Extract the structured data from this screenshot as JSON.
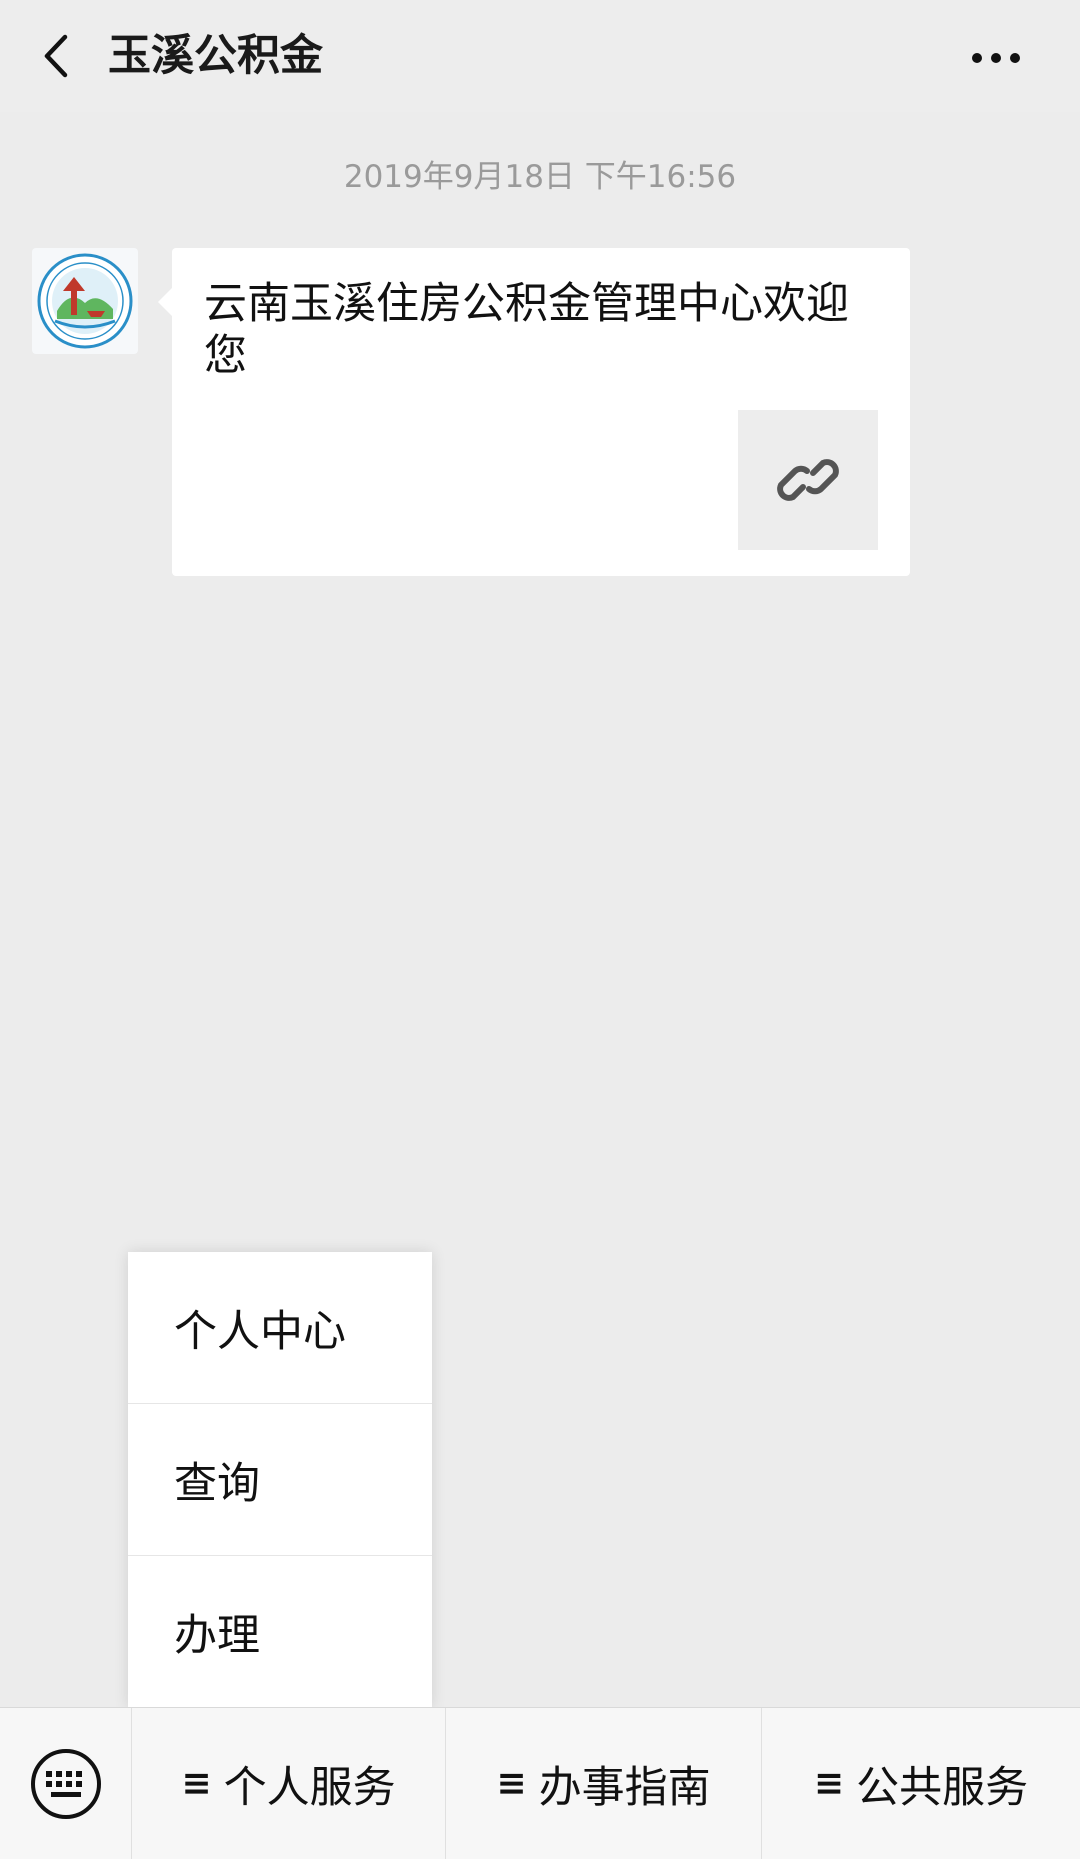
{
  "header": {
    "back_icon": "chevron-left-icon",
    "title": "玉溪公积金",
    "more_icon": "more-dots-icon"
  },
  "chat": {
    "timestamp": "2019年9月18日 下午16:56",
    "message": {
      "avatar_icon": "org-logo-icon",
      "title": "云南玉溪住房公积金管理中心欢迎您",
      "thumbnail_icon": "link-icon"
    }
  },
  "popup_menu": {
    "items": [
      {
        "label": "个人中心"
      },
      {
        "label": "查询"
      },
      {
        "label": "办理"
      }
    ]
  },
  "menubar": {
    "keyboard_icon": "keyboard-icon",
    "menu_icon": "≡",
    "tabs": [
      {
        "label": "个人服务"
      },
      {
        "label": "办事指南"
      },
      {
        "label": "公共服务"
      }
    ]
  }
}
